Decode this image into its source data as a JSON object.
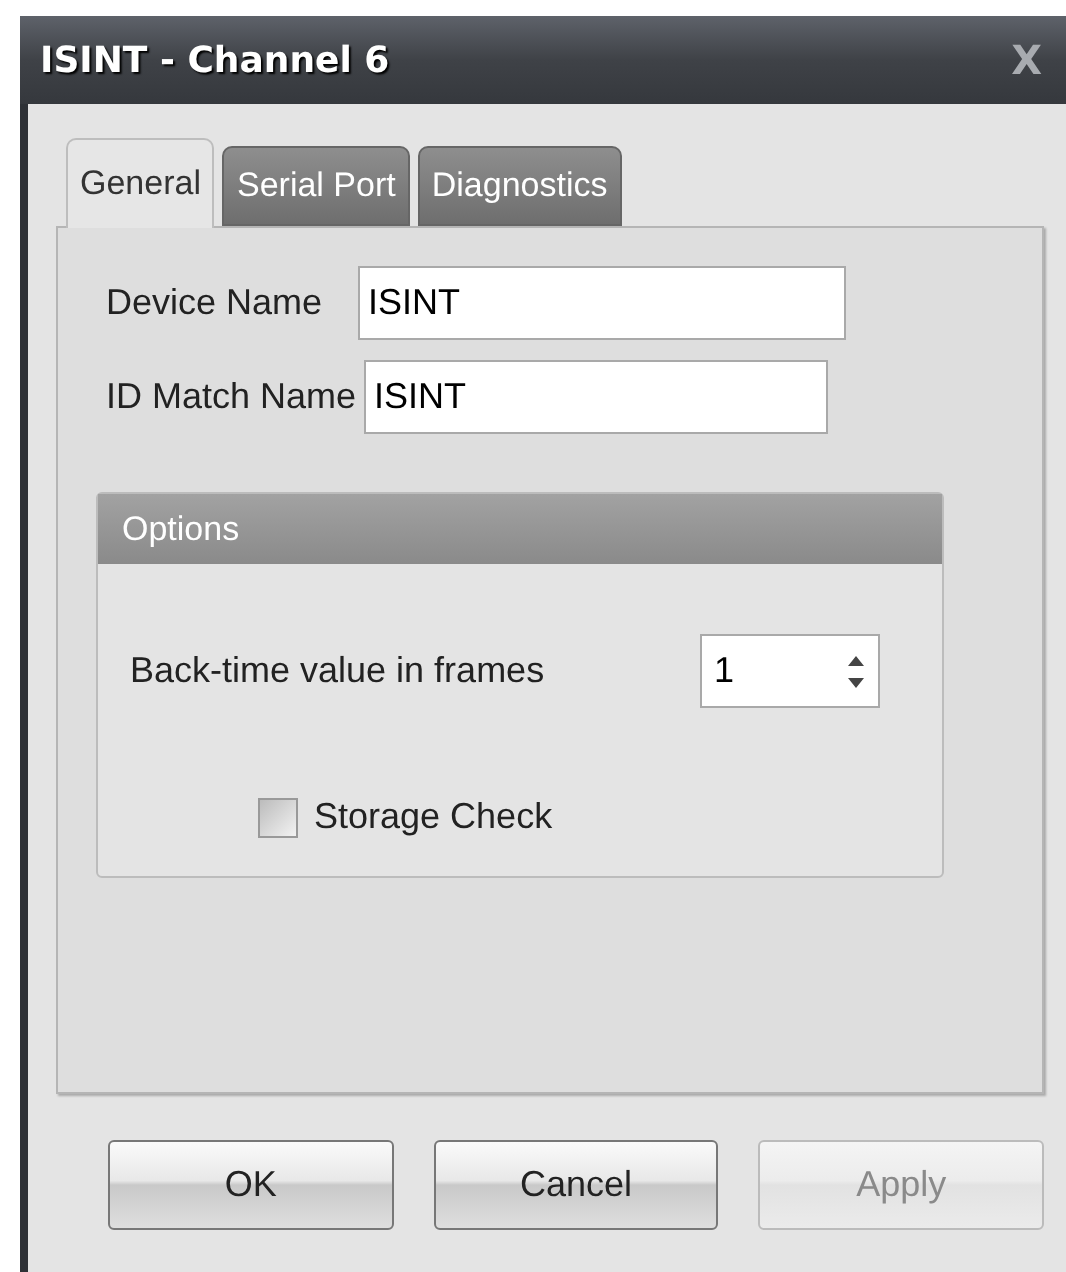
{
  "window": {
    "title": "ISINT - Channel 6",
    "close": "X"
  },
  "tabs": [
    {
      "label": "General",
      "selected": true
    },
    {
      "label": "Serial Port",
      "selected": false
    },
    {
      "label": "Diagnostics",
      "selected": false
    }
  ],
  "fields": [
    {
      "label": "Device Name",
      "value": "ISINT"
    },
    {
      "label": "ID Match Name",
      "value": "ISINT"
    }
  ],
  "options": {
    "title": "Options",
    "spinner": {
      "label": "Back-time value in frames",
      "value": "1"
    },
    "checkbox": {
      "label": "Storage Check",
      "checked": false
    }
  },
  "buttons": [
    {
      "label": "OK",
      "disabled": false
    },
    {
      "label": "Cancel",
      "disabled": false
    },
    {
      "label": "Apply",
      "disabled": true
    }
  ]
}
